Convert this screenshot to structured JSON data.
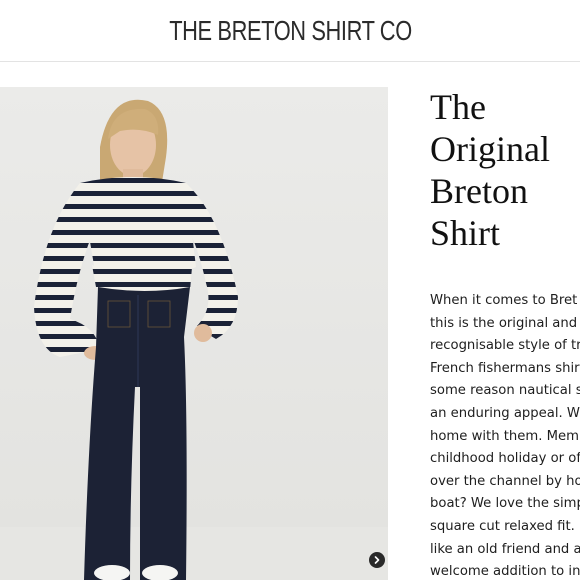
{
  "header": {
    "logo_text": "THE BRETON SHIRT CO"
  },
  "hero": {
    "image_alt": "Woman wearing a navy and white striped Breton shirt with wide-leg dark denim jeans",
    "next_icon": "chevron-right-icon"
  },
  "product": {
    "title": "The\nOriginal\nBreton\nShirt",
    "description_lines": [
      "When it comes to Bret",
      "this is the original and",
      "recognisable style of tr",
      "French fishermans shir",
      "some reason nautical s",
      "an enduring appeal. W",
      "home with them. Mem",
      "childhood holiday or of",
      "over the channel by ho",
      "boat? We love the simp",
      "square cut relaxed fit. ",
      "like an old friend and a",
      "welcome addition to in"
    ]
  },
  "colors": {
    "stripe_navy": "#1b2236",
    "denim": "#1c2235",
    "background": "#ebebe9"
  }
}
